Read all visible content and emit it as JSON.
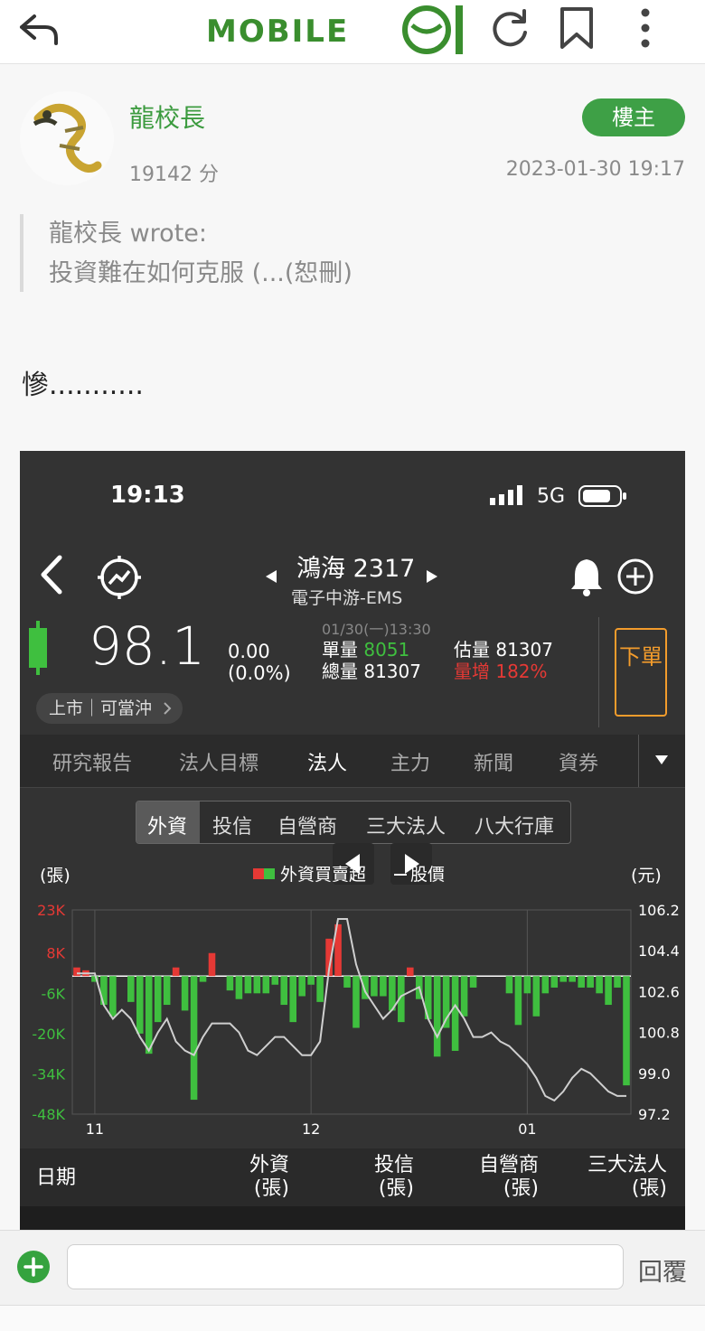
{
  "header": {
    "logo_text": "MOBILE01",
    "icons": [
      "back-icon",
      "refresh-icon",
      "bookmark-icon",
      "more-icon"
    ]
  },
  "post": {
    "username": "龍校長",
    "score": "19142 分",
    "badge": "樓主",
    "time": "2023-01-30 19:17",
    "quote_author": "龍校長 wrote:",
    "quote_text": "投資難在如何克服 (...(恕刪)",
    "body": "慘..........."
  },
  "stock_app": {
    "status_time": "19:13",
    "network": "5G",
    "title": "鴻海 2317",
    "subtitle": "電子中游-EMS",
    "price": "98.1",
    "change": "0.00",
    "change_pct": "(0.0%)",
    "datetime": "01/30(一)13:30",
    "single_vol_label": "單量",
    "single_vol": "8051",
    "total_vol_label": "總量",
    "total_vol": "81307",
    "est_vol_label": "估量",
    "est_vol": "81307",
    "vol_inc_label": "量增",
    "vol_inc": "182%",
    "order_btn": "下單",
    "market_tag": "上市｜可當沖",
    "tabs": [
      "研究報告",
      "法人目標",
      "法人",
      "主力",
      "新聞",
      "資券"
    ],
    "active_tab": "法人",
    "segments": [
      "外資",
      "投信",
      "自營商",
      "三大法人",
      "八大行庫"
    ],
    "active_segment": "外資",
    "colors": {
      "buy": "#e53935",
      "sell": "#3fbf3f",
      "order": "#f39c2c",
      "accent": "#3c9b3f"
    }
  },
  "chart_data": {
    "type": "bar",
    "title": "",
    "legend": [
      "外資買賣超",
      "股價"
    ],
    "left_unit": "(張)",
    "right_unit": "(元)",
    "y_left_ticks": [
      "23K",
      "8K",
      "-6K",
      "-20K",
      "-34K",
      "-48K"
    ],
    "y_right_ticks": [
      "106.2",
      "104.4",
      "102.6",
      "100.8",
      "99.0",
      "97.2"
    ],
    "x_ticks": [
      "11",
      "12",
      "01"
    ],
    "ylim_left": [
      -48000,
      23000
    ],
    "ylim_right": [
      97.2,
      106.2
    ],
    "bars": [
      3000,
      2000,
      -2000,
      -10000,
      -14000,
      0,
      -9000,
      -20000,
      -27000,
      -16000,
      -10000,
      3000,
      -12000,
      -43000,
      -2000,
      8000,
      0,
      -5000,
      -8000,
      -6000,
      -6000,
      -6000,
      -3000,
      -10000,
      -16000,
      -7000,
      -3000,
      -9000,
      13000,
      18000,
      -4000,
      -18000,
      -8000,
      -7000,
      -7000,
      -12000,
      -16000,
      3000,
      -8000,
      -15000,
      -28000,
      -18000,
      -26000,
      -14000,
      -4000,
      0,
      0,
      0,
      -6000,
      -17000,
      -6000,
      -14000,
      -6000,
      -4000,
      -2000,
      -2000,
      -4000,
      -4000,
      -6000,
      -10000,
      -4000,
      -38000
    ],
    "price": [
      103.4,
      103.4,
      103.4,
      102.0,
      101.4,
      101.8,
      101.4,
      100.6,
      100.0,
      100.8,
      101.4,
      100.4,
      100.0,
      99.8,
      100.6,
      101.2,
      101.2,
      101.2,
      100.8,
      100.0,
      99.8,
      100.2,
      100.6,
      100.6,
      100.2,
      99.8,
      99.8,
      100.4,
      103.6,
      105.8,
      105.8,
      103.8,
      102.6,
      102.0,
      101.4,
      101.8,
      102.4,
      102.6,
      102.8,
      101.4,
      100.6,
      101.4,
      102.0,
      101.4,
      100.6,
      100.6,
      100.8,
      100.4,
      100.2,
      99.8,
      99.4,
      98.8,
      98.0,
      97.8,
      98.2,
      98.8,
      99.2,
      99.0,
      98.6,
      98.2,
      98.0,
      98.0
    ]
  },
  "table": {
    "headers": [
      {
        "line1": "日期",
        "line2": ""
      },
      {
        "line1": "外資",
        "line2": "(張)"
      },
      {
        "line1": "投信",
        "line2": "(張)"
      },
      {
        "line1": "自營商",
        "line2": "(張)"
      },
      {
        "line1": "三大法人",
        "line2": "(張)"
      }
    ]
  },
  "compose": {
    "placeholder": "",
    "reply_label": "回覆"
  }
}
